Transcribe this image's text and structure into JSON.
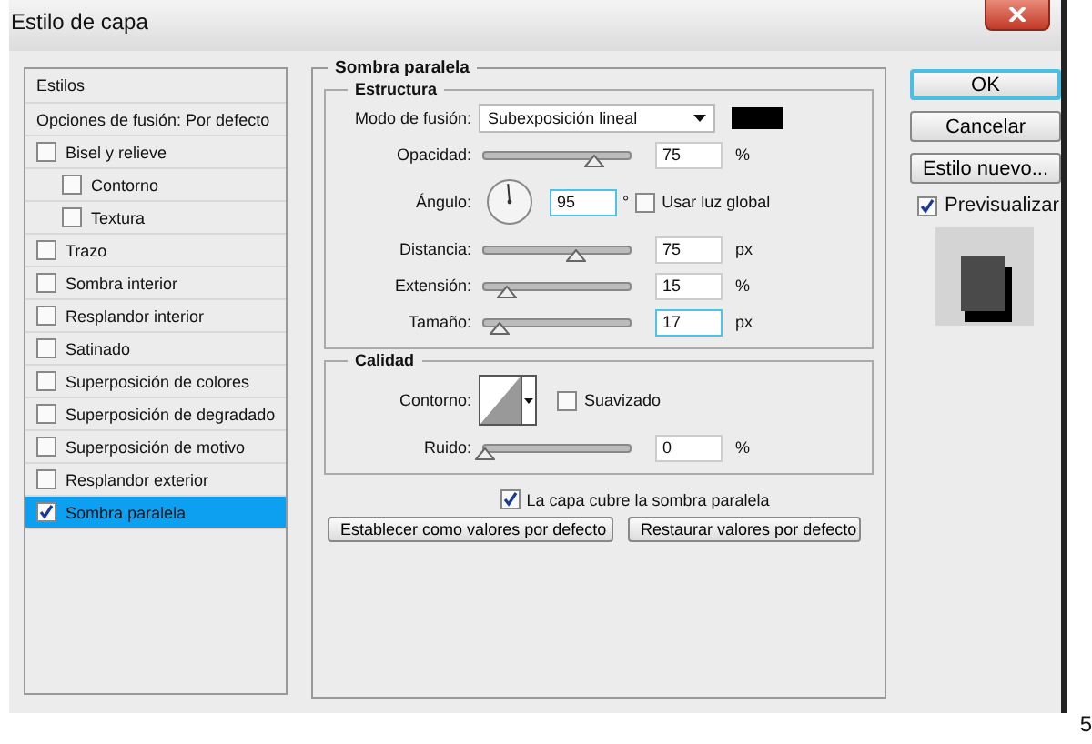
{
  "window": {
    "title": "Estilo de capa"
  },
  "styles": [
    {
      "kind": "header",
      "label": "Estilos",
      "selected": false
    },
    {
      "kind": "option",
      "label": "Opciones de fusión: Por defecto",
      "selected": false
    },
    {
      "kind": "check",
      "label": "Bisel y relieve",
      "checked": false,
      "selected": false,
      "children": [
        {
          "kind": "check",
          "label": "Contorno",
          "checked": false,
          "selected": false
        },
        {
          "kind": "check",
          "label": "Textura",
          "checked": false,
          "selected": false
        }
      ]
    },
    {
      "kind": "check",
      "label": "Trazo",
      "checked": false,
      "selected": false
    },
    {
      "kind": "check",
      "label": "Sombra interior",
      "checked": false,
      "selected": false
    },
    {
      "kind": "check",
      "label": "Resplandor interior",
      "checked": false,
      "selected": false
    },
    {
      "kind": "check",
      "label": "Satinado",
      "checked": false,
      "selected": false
    },
    {
      "kind": "check",
      "label": "Superposición de colores",
      "checked": false,
      "selected": false
    },
    {
      "kind": "check",
      "label": "Superposición de degradado",
      "checked": false,
      "selected": false
    },
    {
      "kind": "check",
      "label": "Superposición de motivo",
      "checked": false,
      "selected": false
    },
    {
      "kind": "check",
      "label": "Resplandor exterior",
      "checked": false,
      "selected": false
    },
    {
      "kind": "check",
      "label": "Sombra paralela",
      "checked": true,
      "selected": true
    }
  ],
  "panel": {
    "title": "Sombra paralela",
    "structure": {
      "title": "Estructura",
      "blend_label": "Modo de fusión:",
      "blend_value": "Subexposición lineal",
      "color": "#000000",
      "rows": [
        {
          "kind": "slider",
          "label": "Opacidad:",
          "level": 0.75,
          "value": "75",
          "unit": "%",
          "focused": false
        },
        {
          "kind": "angle",
          "label": "Ángulo:",
          "value": "95",
          "unit": "°",
          "global_label": "Usar luz global",
          "global_checked": false,
          "focused": true
        },
        {
          "kind": "slider",
          "label": "Distancia:",
          "level": 0.62,
          "value": "75",
          "unit": "px",
          "focused": false
        },
        {
          "kind": "slider",
          "label": "Extensión:",
          "level": 0.15,
          "value": "15",
          "unit": "%",
          "focused": false
        },
        {
          "kind": "slider",
          "label": "Tamaño:",
          "level": 0.1,
          "value": "17",
          "unit": "px",
          "focused": true
        }
      ]
    },
    "quality": {
      "title": "Calidad",
      "contour_label": "Contorno:",
      "antialias_label": "Suavizado",
      "antialias_checked": false,
      "rows": [
        {
          "kind": "slider",
          "label": "Ruido:",
          "level": 0,
          "value": "0",
          "unit": "%",
          "focused": false
        }
      ]
    },
    "knockout": {
      "label": "La capa cubre la sombra paralela",
      "checked": true
    },
    "buttons": [
      "Establecer como valores por defecto",
      "Restaurar valores por defecto"
    ]
  },
  "actions": [
    {
      "label": "OK",
      "default": true
    },
    {
      "label": "Cancelar",
      "default": false
    },
    {
      "label": "Estilo nuevo...",
      "default": false
    }
  ],
  "preview": {
    "label": "Previsualizar",
    "checked": true
  },
  "page_number": "5"
}
